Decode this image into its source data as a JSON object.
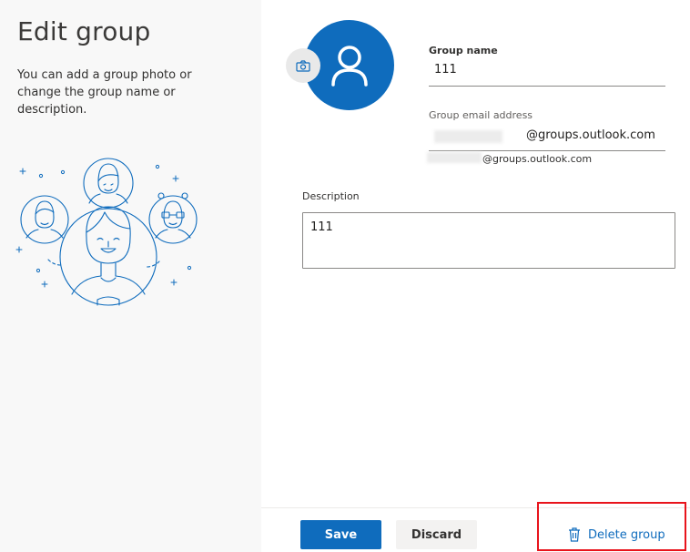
{
  "page": {
    "title": "Edit group",
    "description": "You can add a group photo or change the group name or description."
  },
  "photo": {
    "avatar_icon": "person-icon",
    "camera_icon": "camera-icon",
    "accent": "#0f6cbd"
  },
  "group_name": {
    "label": "Group name",
    "value": "111"
  },
  "group_email": {
    "label": "Group email address",
    "domain_suffix": "@groups.outlook.com",
    "full_suffix": "@groups.outlook.com"
  },
  "description_field": {
    "label": "Description",
    "value": "111"
  },
  "footer": {
    "save_label": "Save",
    "discard_label": "Discard",
    "delete_label": "Delete group",
    "delete_icon": "trash-icon",
    "highlight_color": "#e8141c"
  }
}
